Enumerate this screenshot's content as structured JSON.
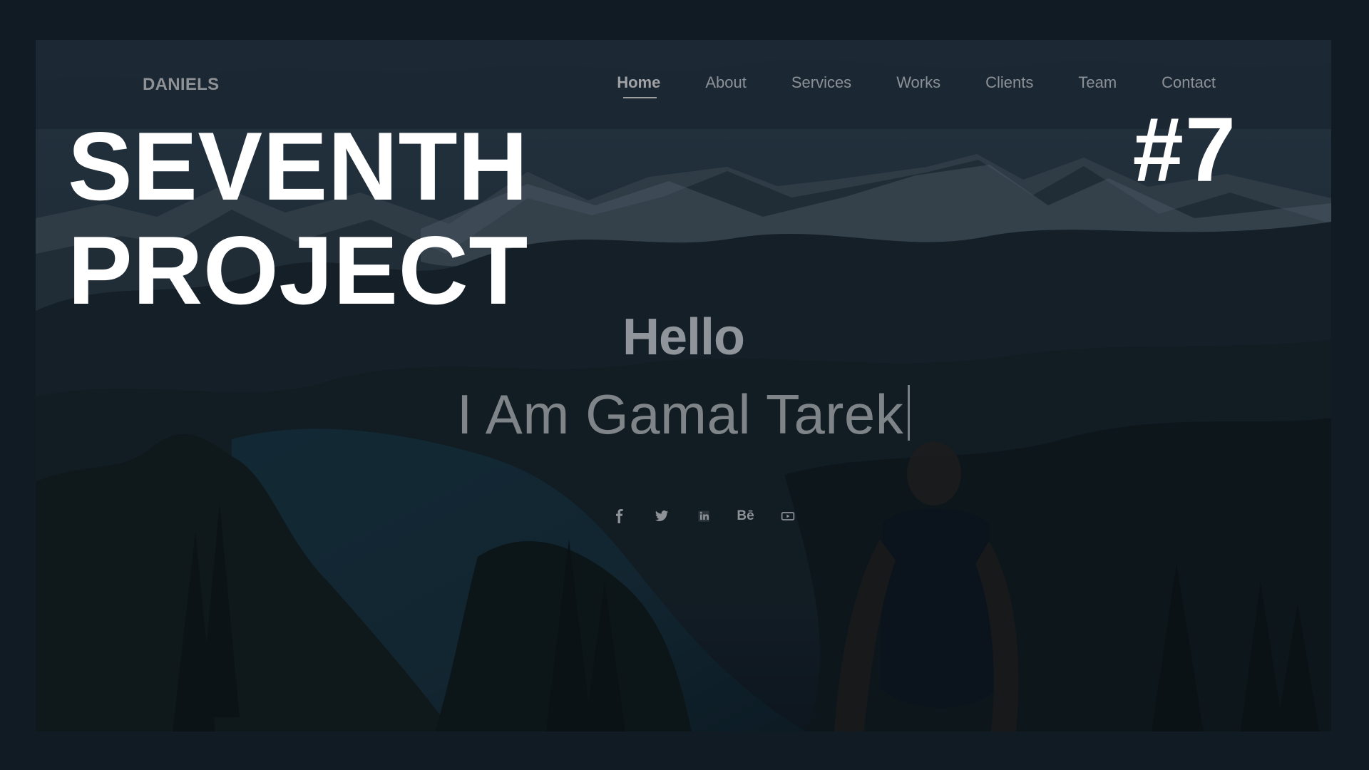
{
  "site": {
    "brand": "DANIELS",
    "nav": [
      "Home",
      "About",
      "Services",
      "Works",
      "Clients",
      "Team",
      "Contact"
    ],
    "hero": {
      "greeting": "Hello",
      "name_line": "I Am Gamal Tarek"
    },
    "socials": [
      "facebook-icon",
      "twitter-icon",
      "linkedin-icon",
      "behance-icon",
      "youtube-icon"
    ],
    "behance_label": "Bē"
  },
  "cover": {
    "title_line_1": "SEVENTH",
    "title_line_2": "PROJECT",
    "number": "#7"
  },
  "colors": {
    "page_bg": "#101b24",
    "title": "#ffffff",
    "muted_text": "#8d9297"
  }
}
